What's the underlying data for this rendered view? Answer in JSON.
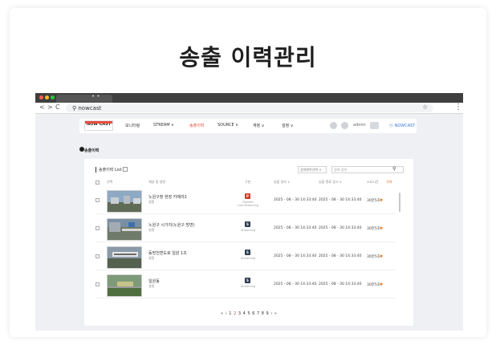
{
  "heading": "송출 이력관리",
  "browser": {
    "url": "nowcast",
    "nav_back": "<",
    "nav_forward": ">",
    "nav_reload": "C",
    "search_glyph": "⚲",
    "star_glyph": "☆",
    "menu_glyph": "⋮",
    "tab_dots": "• •"
  },
  "app": {
    "logo": "NOW CAST",
    "nav": [
      {
        "label": "모니터링"
      },
      {
        "label": "STREAM ∨"
      },
      {
        "label": "송출이력",
        "active": true
      },
      {
        "label": "SOURCE ∨"
      },
      {
        "label": "계정 ∨"
      },
      {
        "label": "설정 ∨"
      }
    ],
    "user": "admin",
    "brand": "ⓝ NOWCAST"
  },
  "page": {
    "section_title": "송출이력",
    "list_title": "송출이력 List",
    "select_value": "검색항목선택 ∨",
    "search_placeholder": "검색 검색"
  },
  "table": {
    "headers": [
      "선택",
      "채널 및 설명",
      "구분",
      "송출 일자 ∨",
      "송출 종료 일시 ∨",
      "소요시간",
      "삭제"
    ],
    "rows": [
      {
        "title": "노원구청 현장 카메라2",
        "sub": "설명",
        "badge": "P",
        "badge_color": "#d9342b",
        "type": "Transfer\nLive Streaming",
        "start": "2025 - 08 - 30  14:33:40",
        "end": "2025 - 08 - 30  14:33:40",
        "duration": "30분5초",
        "thumb": "a"
      },
      {
        "title": "노원구 시가지(노원구 방면)",
        "sub": "설명",
        "badge": "S",
        "badge_color": "#2d3e50",
        "type": "Streaming",
        "start": "2025 - 08 - 30  14:33:40",
        "end": "2025 - 08 - 30  14:33:40",
        "duration": "30분5초",
        "thumb": "b"
      },
      {
        "title": "동방천변도로 일원 1조",
        "sub": "설명",
        "badge": "S",
        "badge_color": "#2d3e50",
        "type": "Streaming",
        "start": "2025 - 08 - 30  14:33:40",
        "end": "2025 - 08 - 30  14:33:40",
        "duration": "30분5초",
        "thumb": "c"
      },
      {
        "title": "일원동",
        "sub": "설명",
        "badge": "S",
        "badge_color": "#2d3e50",
        "type": "Streaming",
        "start": "2025 - 08 - 30  14:33:40",
        "end": "2025 - 08 - 30  14:33:40",
        "duration": "30분5초",
        "thumb": "d"
      }
    ],
    "delete_glyph": "✱"
  },
  "pagination": {
    "first": "«",
    "prev": "‹",
    "pages": [
      "1",
      "2",
      "3",
      "4",
      "5",
      "6",
      "7",
      "8",
      "9"
    ],
    "current": "2",
    "next": "›",
    "last": "»"
  }
}
